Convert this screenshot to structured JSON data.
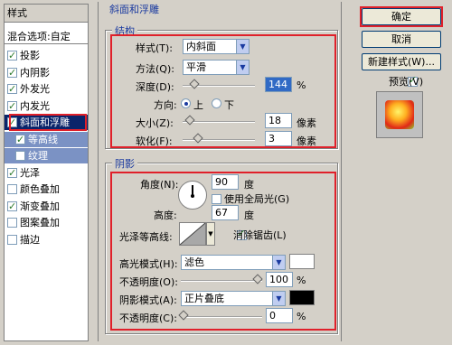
{
  "left_panel": {
    "title": "样式",
    "blending": "混合选项:自定",
    "items": [
      {
        "label": "投影",
        "checked": true
      },
      {
        "label": "内阴影",
        "checked": true
      },
      {
        "label": "外发光",
        "checked": true
      },
      {
        "label": "内发光",
        "checked": true
      },
      {
        "label": "斜面和浮雕",
        "checked": true
      },
      {
        "label": "等高线",
        "checked": true
      },
      {
        "label": "纹理",
        "checked": false
      },
      {
        "label": "光泽",
        "checked": true
      },
      {
        "label": "颜色叠加",
        "checked": false
      },
      {
        "label": "渐变叠加",
        "checked": true
      },
      {
        "label": "图案叠加",
        "checked": false
      },
      {
        "label": "描边",
        "checked": false
      }
    ]
  },
  "main": {
    "section_title": "斜面和浮雕",
    "structure": {
      "legend": "结构",
      "style_label": "样式(T):",
      "style_value": "内斜面",
      "technique_label": "方法(Q):",
      "technique_value": "平滑",
      "depth_label": "深度(D):",
      "depth_value": "144",
      "depth_unit": "%",
      "depth_level": 0.14,
      "direction_label": "方向:",
      "dir_up": "上",
      "dir_down": "下",
      "size_label": "大小(Z):",
      "size_value": "18",
      "size_unit": "像素",
      "size_level": 0.07,
      "soften_label": "软化(F):",
      "soften_value": "3",
      "soften_unit": "像素",
      "soften_level": 0.2
    },
    "shading": {
      "legend": "阴影",
      "angle_label": "角度(N):",
      "angle_value": "90",
      "angle_unit": "度",
      "global_light_label": "使用全局光(G)",
      "altitude_label": "高度:",
      "altitude_value": "67",
      "altitude_unit": "度",
      "gloss_label": "光泽等高线:",
      "antialias_label": "消除锯齿(L)",
      "highlight_mode_label": "高光模式(H):",
      "highlight_mode_value": "滤色",
      "highlight_color": "#ffffff",
      "opacity1_label": "不透明度(O):",
      "opacity1_value": "100",
      "opacity1_level": 1.0,
      "opacity_unit": "%",
      "shadow_mode_label": "阴影模式(A):",
      "shadow_mode_value": "正片叠底",
      "shadow_color": "#000000",
      "opacity2_label": "不透明度(C):",
      "opacity2_value": "0",
      "opacity2_level": 0.0
    }
  },
  "buttons": {
    "ok": "确定",
    "cancel": "取消",
    "new_style": "新建样式(W)...",
    "preview": "预览(V)"
  },
  "colors": {
    "highlight_border": "#e0202a",
    "legend_text": "#1a3aa0",
    "selected_row": "#0a246a"
  }
}
